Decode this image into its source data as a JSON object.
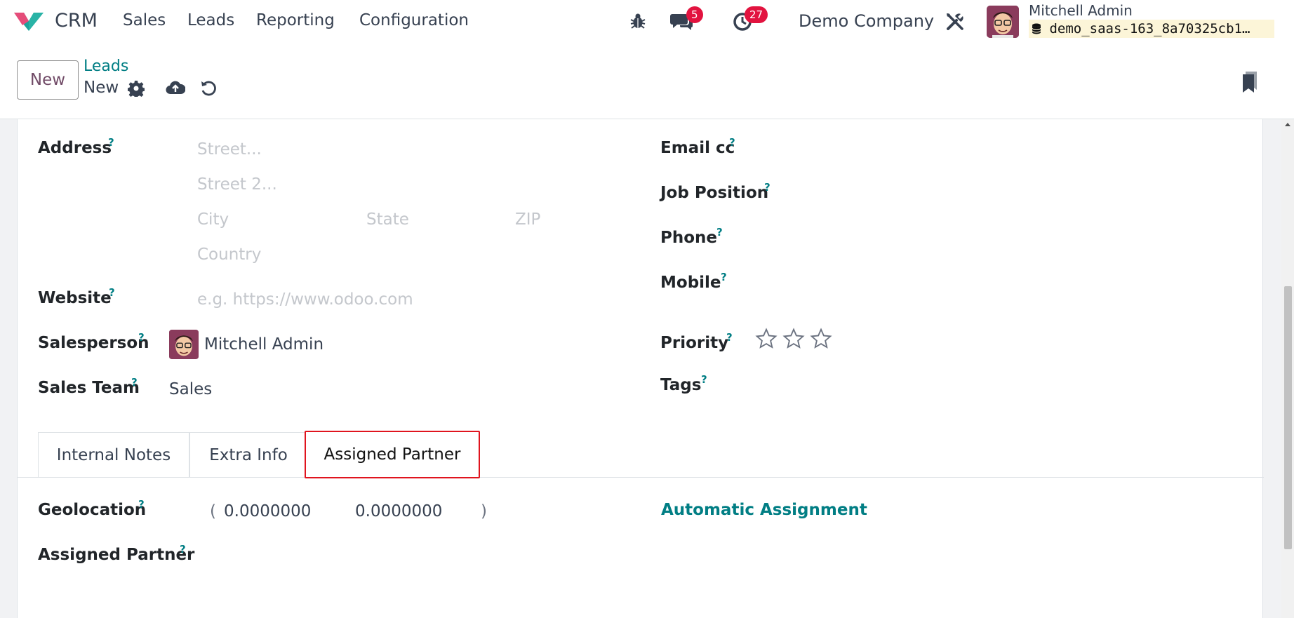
{
  "navbar": {
    "app_name": "CRM",
    "menu": [
      "Sales",
      "Leads",
      "Reporting",
      "Configuration"
    ],
    "messages_count": "5",
    "activities_count": "27",
    "company": "Demo Company",
    "user_name": "Mitchell Admin",
    "database": "demo_saas-163_8a70325cb1…",
    "icons": [
      "bug-icon",
      "chat-icon",
      "clock-icon",
      "tools-icon",
      "database-icon"
    ]
  },
  "control_panel": {
    "new_button": "New",
    "breadcrumb_parent": "Leads",
    "breadcrumb_current": "New",
    "icons": [
      "gear-icon",
      "cloud-upload-icon",
      "undo-icon",
      "bookmark-icon"
    ]
  },
  "form": {
    "address_label": "Address",
    "street_placeholder": "Street...",
    "street2_placeholder": "Street 2...",
    "city_placeholder": "City",
    "state_placeholder": "State",
    "zip_placeholder": "ZIP",
    "country_placeholder": "Country",
    "website_label": "Website",
    "website_placeholder": "e.g. https://www.odoo.com",
    "salesperson_label": "Salesperson",
    "salesperson_value": "Mitchell Admin",
    "sales_team_label": "Sales Team",
    "sales_team_value": "Sales",
    "email_cc_label": "Email cc",
    "job_position_label": "Job Position",
    "phone_label": "Phone",
    "mobile_label": "Mobile",
    "priority_label": "Priority",
    "priority_stars": 0,
    "priority_max": 3,
    "tags_label": "Tags",
    "help_mark": "?"
  },
  "tabs": [
    {
      "label": "Internal Notes",
      "active": false
    },
    {
      "label": "Extra Info",
      "active": false
    },
    {
      "label": "Assigned Partner",
      "active": true
    }
  ],
  "assigned_partner_tab": {
    "geolocation_label": "Geolocation",
    "open_paren": "(",
    "latitude": "0.0000000",
    "longitude": "0.0000000",
    "close_paren": ")",
    "assigned_partner_label": "Assigned Partner",
    "automatic_assignment": "Automatic Assignment"
  },
  "colors": {
    "accent": "#017e84",
    "brand": "#714b67",
    "badge": "#e2133f",
    "highlight": "#e0141e"
  }
}
